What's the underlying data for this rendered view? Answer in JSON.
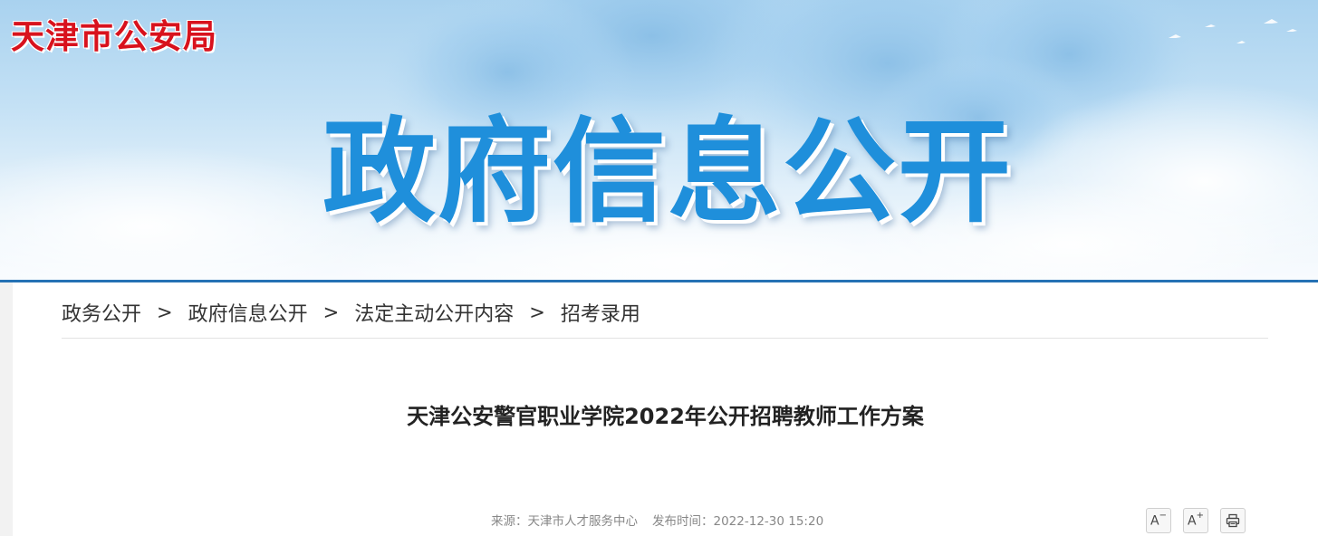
{
  "header": {
    "site_name": "天津市公安局",
    "banner_title": "政府信息公开"
  },
  "breadcrumb": {
    "items": [
      {
        "label": "政务公开"
      },
      {
        "label": "政府信息公开"
      },
      {
        "label": "法定主动公开内容"
      },
      {
        "label": "招考录用"
      }
    ],
    "separator": ">"
  },
  "article": {
    "title": "天津公安警官职业学院2022年公开招聘教师工作方案",
    "source_label": "来源：",
    "source": "天津市人才服务中心",
    "published_label": "发布时间：",
    "published": "2022-12-30 15:20"
  },
  "toolbar": {
    "font_decrease_label": "A",
    "font_decrease_mark": "−",
    "font_increase_label": "A",
    "font_increase_mark": "+"
  },
  "colors": {
    "accent": "#2571b4",
    "site_name": "#d8121d",
    "banner_title": "#1f8fdb"
  }
}
